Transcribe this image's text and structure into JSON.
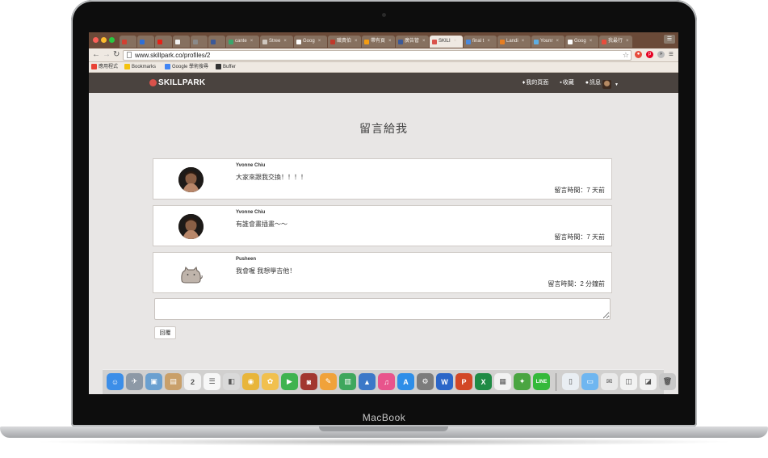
{
  "device": {
    "label": "MacBook"
  },
  "browser": {
    "tabs": [
      {
        "label": "",
        "favicon_color": "#d23f31"
      },
      {
        "label": "",
        "favicon_color": "#2f6fd6"
      },
      {
        "label": "",
        "favicon_color": "#e62117"
      },
      {
        "label": "",
        "favicon_color": "#f1f1f1"
      },
      {
        "label": "",
        "favicon_color": "#8a8a8a"
      },
      {
        "label": "",
        "favicon_color": "#3b5998"
      },
      {
        "label": "cante",
        "favicon_color": "#3aa76d"
      },
      {
        "label": "Stree",
        "favicon_color": "#cfc7bf"
      },
      {
        "label": "Goog",
        "favicon_color": "#ffffff"
      },
      {
        "label": "職責伯",
        "favicon_color": "#c0392b"
      },
      {
        "label": "帶有頁",
        "favicon_color": "#f39c12"
      },
      {
        "label": "廣告管",
        "favicon_color": "#3b5998"
      },
      {
        "label": "SKILI",
        "favicon_color": "#d9524b",
        "active": true
      },
      {
        "label": "final t",
        "favicon_color": "#4a89dc"
      },
      {
        "label": "Landi",
        "favicon_color": "#e67e22"
      },
      {
        "label": "Younr",
        "favicon_color": "#5dade2"
      },
      {
        "label": "Goog",
        "favicon_color": "#ffffff"
      },
      {
        "label": "我最行",
        "favicon_color": "#e74c3c"
      }
    ],
    "url": "www.skillpark.co/profiles/2",
    "bookmarks": [
      {
        "label": "應用程式",
        "icon_color": "#e94235"
      },
      {
        "label": "Bookmarks",
        "icon_color": "#f4c20d"
      },
      {
        "label": "Google 學術搜尋",
        "icon_color": "#4285f4"
      },
      {
        "label": "Buffer",
        "icon_color": "#333333"
      }
    ]
  },
  "site": {
    "logo": "SKILLPARK",
    "nav": [
      {
        "label": "我的頁面",
        "icon": "pin-icon"
      },
      {
        "label": "收藏",
        "icon": "inbox-icon"
      },
      {
        "label": "訊息",
        "icon": "chat-icon"
      }
    ]
  },
  "page": {
    "title": "留言給我",
    "comments": [
      {
        "author": "Yvonne Chiu",
        "text": "大家來跟我交換！！！！",
        "time": "留言時間：7 天前",
        "avatar": "photo"
      },
      {
        "author": "Yvonne Chiu",
        "text": "有誰會畫插畫～～",
        "time": "留言時間：7 天前",
        "avatar": "photo"
      },
      {
        "author": "Pusheen",
        "text": "我會喔 我想學吉他！",
        "time": "留言時間：2 分鐘前",
        "avatar": "cat"
      }
    ],
    "reply_placeholder": "",
    "reply_button": "回覆"
  },
  "dock": {
    "items": [
      {
        "name": "finder",
        "color": "#3c8ee8",
        "glyph": "☺"
      },
      {
        "name": "launchpad",
        "color": "#8d99a6",
        "glyph": "✈"
      },
      {
        "name": "preview",
        "color": "#6aa0d0",
        "glyph": "▣"
      },
      {
        "name": "notes",
        "color": "#c9a06a",
        "glyph": "▤"
      },
      {
        "name": "calendar",
        "color": "#f2f2f2",
        "glyph": "2"
      },
      {
        "name": "reminders",
        "color": "#f7f7f7",
        "glyph": "☰"
      },
      {
        "name": "photos-viewer",
        "color": "#d9d9d9",
        "glyph": "◧"
      },
      {
        "name": "chrome",
        "color": "#e8b53a",
        "glyph": "◉"
      },
      {
        "name": "photos",
        "color": "#f1c04f",
        "glyph": "✿"
      },
      {
        "name": "facetime",
        "color": "#3fb34f",
        "glyph": "▶"
      },
      {
        "name": "photo-booth",
        "color": "#a2372f",
        "glyph": "◙"
      },
      {
        "name": "pages",
        "color": "#f0a23a",
        "glyph": "✎"
      },
      {
        "name": "numbers",
        "color": "#3ea75d",
        "glyph": "▥"
      },
      {
        "name": "keynote",
        "color": "#3c78c8",
        "glyph": "▲"
      },
      {
        "name": "itunes",
        "color": "#e8548c",
        "glyph": "♫"
      },
      {
        "name": "app-store",
        "color": "#2e8ee8",
        "glyph": "A"
      },
      {
        "name": "system-preferences",
        "color": "#7c7c7c",
        "glyph": "⚙"
      },
      {
        "name": "word",
        "color": "#2b66c8",
        "glyph": "W"
      },
      {
        "name": "powerpoint",
        "color": "#d24726",
        "glyph": "P"
      },
      {
        "name": "excel",
        "color": "#1f8b45",
        "glyph": "X"
      },
      {
        "name": "calculator-grid",
        "color": "#f2f2f2",
        "glyph": "▦"
      },
      {
        "name": "evernote",
        "color": "#4aa541",
        "glyph": "✦"
      },
      {
        "name": "line",
        "color": "#35b93b",
        "glyph": "LINE"
      },
      {
        "name": "document",
        "color": "#e9eef3",
        "glyph": "▯"
      },
      {
        "name": "folder",
        "color": "#6fb6f0",
        "glyph": "▭"
      },
      {
        "name": "mail-stack",
        "color": "#e9e9e9",
        "glyph": "✉"
      },
      {
        "name": "image-stack",
        "color": "#f2f2f2",
        "glyph": "◫"
      },
      {
        "name": "pdf-stack",
        "color": "#f2f2f2",
        "glyph": "◪"
      },
      {
        "name": "trash",
        "color": "#c8c8c8",
        "glyph": "🗑"
      }
    ]
  }
}
